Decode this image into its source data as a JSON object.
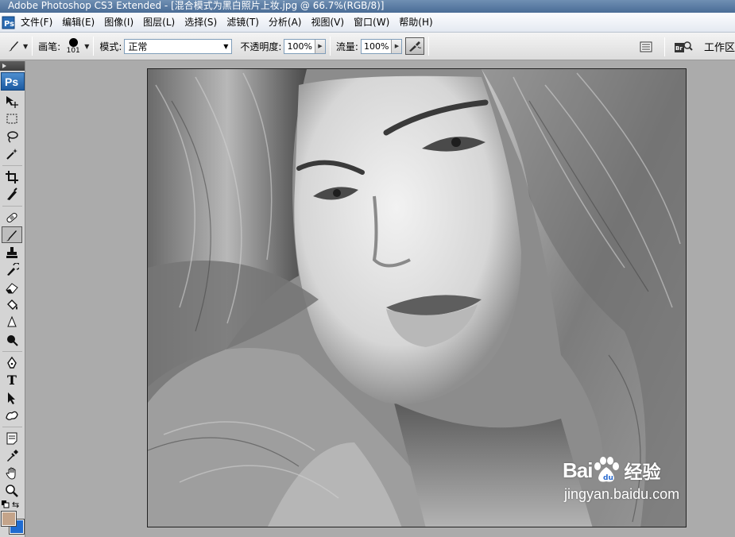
{
  "window": {
    "title": "Adobe Photoshop CS3 Extended - [混合模式为黑白照片上妆.jpg @ 66.7%(RGB/8)]"
  },
  "menu": {
    "items": [
      "文件(F)",
      "编辑(E)",
      "图像(I)",
      "图层(L)",
      "选择(S)",
      "滤镜(T)",
      "分析(A)",
      "视图(V)",
      "窗口(W)",
      "帮助(H)"
    ]
  },
  "options": {
    "brush_label": "画笔:",
    "brush_size": "101",
    "mode_label": "模式:",
    "mode_value": "正常",
    "opacity_label": "不透明度:",
    "opacity_value": "100%",
    "flow_label": "流量:",
    "flow_value": "100%",
    "workspace_label": "工作区"
  },
  "toolbox": {
    "logo": "Ps",
    "type_tool_glyph": "T",
    "foreground_color": "#c4a48a",
    "background_color": "#1f6bd0"
  },
  "document": {
    "filename": "混合模式为黑白照片上妆.jpg",
    "zoom": "66.7%",
    "mode": "RGB/8"
  },
  "watermark": {
    "brand_prefix": "Bai",
    "brand_suffix": "经验",
    "url": "jingyan.baidu.com"
  },
  "colors": {
    "title_bar": "#4a6c96",
    "workspace_bg": "#ababab",
    "ps_blue": "#1c5aa1"
  }
}
